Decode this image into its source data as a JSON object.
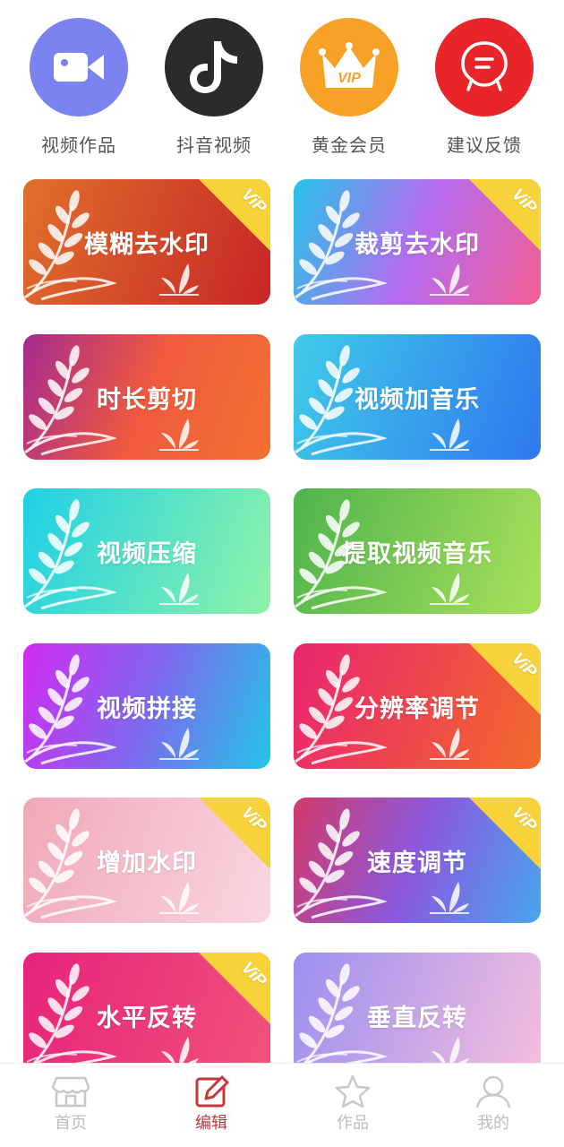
{
  "shortcuts": [
    {
      "label": "视频作品",
      "icon": "video-camera-icon",
      "color": "#7b83f0"
    },
    {
      "label": "抖音视频",
      "icon": "tiktok-icon",
      "color": "#2b2b2b"
    },
    {
      "label": "黄金会员",
      "icon": "vip-crown-icon",
      "color": "#f7a227"
    },
    {
      "label": "建议反馈",
      "icon": "feedback-chat-icon",
      "color": "#e8262a"
    }
  ],
  "features": [
    {
      "label": "模糊去水印",
      "vip": true,
      "gradient": [
        "#e0702c",
        "#c72626"
      ]
    },
    {
      "label": "裁剪去水印",
      "vip": true,
      "gradient": [
        "#27c3e8",
        "#b66bf0",
        "#f25e93"
      ]
    },
    {
      "label": "时长剪切",
      "vip": false,
      "gradient": [
        "#a52b8f",
        "#f05a3e",
        "#f27130"
      ]
    },
    {
      "label": "视频加音乐",
      "vip": false,
      "gradient": [
        "#3fcbe8",
        "#2f78ef"
      ]
    },
    {
      "label": "视频压缩",
      "vip": false,
      "gradient": [
        "#1fd0e6",
        "#8ef3a8"
      ]
    },
    {
      "label": "提取视频音乐",
      "vip": false,
      "gradient": [
        "#4fb34c",
        "#a8e15a"
      ]
    },
    {
      "label": "视频拼接",
      "vip": false,
      "gradient": [
        "#d22bf2",
        "#7f68ee",
        "#22c5e6"
      ]
    },
    {
      "label": "分辨率调节",
      "vip": true,
      "gradient": [
        "#ea2570",
        "#f26a2a"
      ]
    },
    {
      "label": "增加水印",
      "vip": true,
      "gradient": [
        "#f0a8b8",
        "#f9d6e0"
      ]
    },
    {
      "label": "速度调节",
      "vip": true,
      "gradient": [
        "#d23a6b",
        "#8a5ae0",
        "#47a5ee"
      ]
    },
    {
      "label": "水平反转",
      "vip": true,
      "gradient": [
        "#e8237c",
        "#f0537a"
      ]
    },
    {
      "label": "垂直反转",
      "vip": false,
      "gradient": [
        "#9b8ff0",
        "#f5bedc"
      ]
    }
  ],
  "vip_badge": "ViP",
  "nav": [
    {
      "label": "首页",
      "icon": "shop-icon",
      "active": false
    },
    {
      "label": "编辑",
      "icon": "edit-icon",
      "active": true
    },
    {
      "label": "作品",
      "icon": "star-icon",
      "active": false
    },
    {
      "label": "我的",
      "icon": "user-icon",
      "active": false
    }
  ]
}
